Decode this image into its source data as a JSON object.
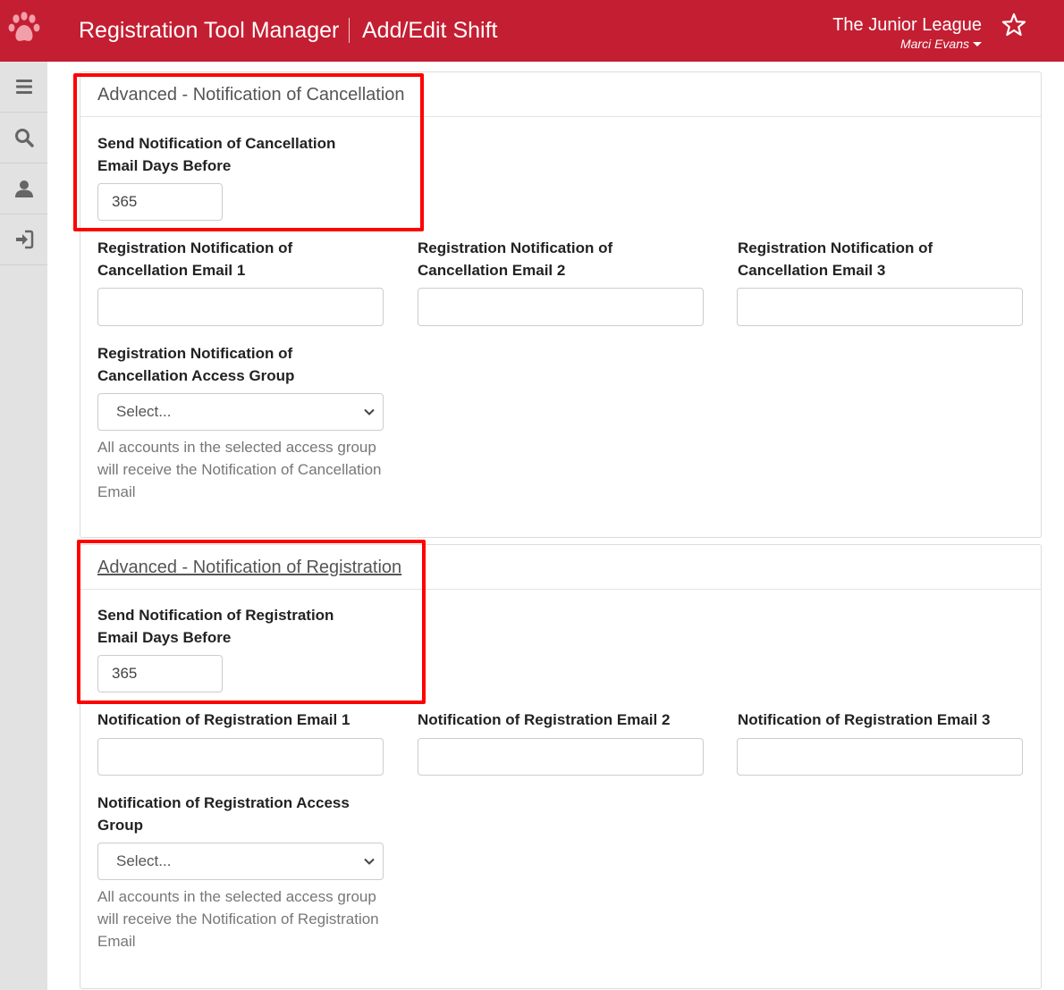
{
  "header": {
    "app_title": "Registration Tool Manager",
    "page_title": "Add/Edit Shift",
    "org_name": "The Junior League",
    "user_name": "Marci Evans",
    "brand_color": "#c41e32"
  },
  "sidebar": {
    "items": [
      {
        "icon": "menu-icon"
      },
      {
        "icon": "search-icon"
      },
      {
        "icon": "user-icon"
      },
      {
        "icon": "sign-in-icon"
      }
    ]
  },
  "cancellation": {
    "heading": "Advanced - Notification of Cancellation",
    "days_label": "Send Notification of Cancellation Email Days Before",
    "days_value": "365",
    "email1_label": "Registration Notification of Cancellation Email 1",
    "email1_value": "",
    "email2_label": "Registration Notification of Cancellation Email 2",
    "email2_value": "",
    "email3_label": "Registration Notification of Cancellation Email 3",
    "email3_value": "",
    "group_label": "Registration Notification of Cancellation Access Group",
    "group_selected": "Select...",
    "group_help": "All accounts in the selected access group will receive the Notification of Cancellation Email"
  },
  "registration": {
    "heading": "Advanced - Notification of Registration",
    "days_label": "Send Notification of Registration Email Days Before",
    "days_value": "365",
    "email1_label": "Notification of Registration Email 1",
    "email1_value": "",
    "email2_label": "Notification of Registration Email 2",
    "email2_value": "",
    "email3_label": "Notification of Registration Email 3",
    "email3_value": "",
    "group_label": "Notification of Registration Access Group",
    "group_selected": "Select...",
    "group_help": "All accounts in the selected access group will receive the Notification of Registration Email"
  },
  "highlight_color": "#ff0000"
}
